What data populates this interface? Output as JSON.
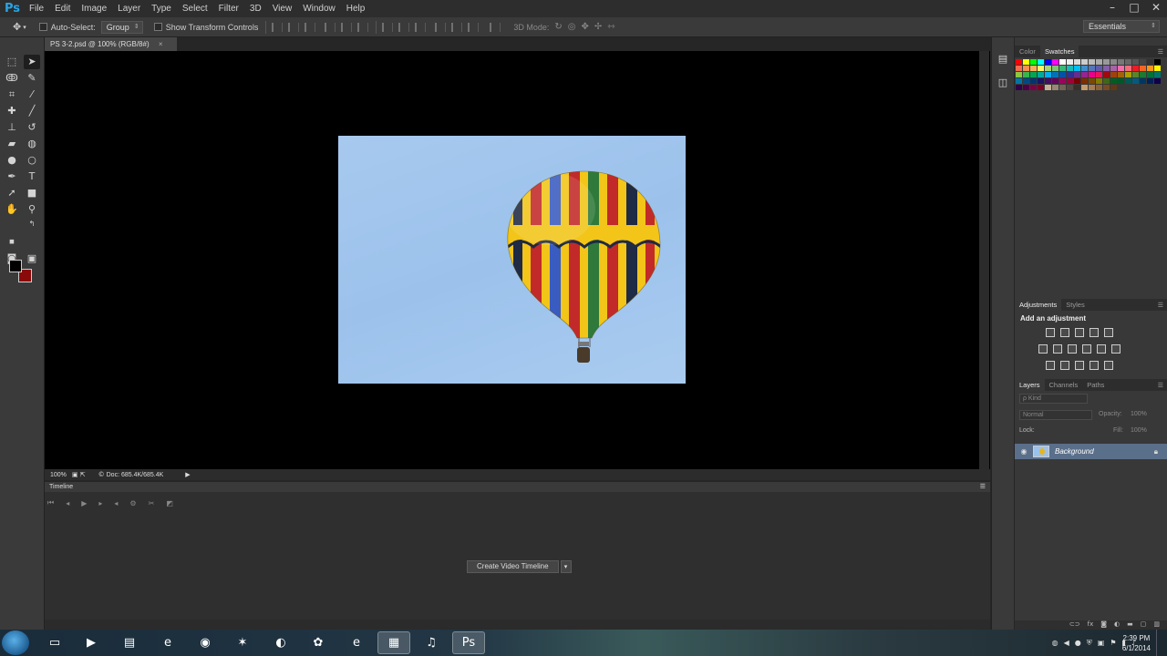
{
  "app": {
    "logo": "Ps",
    "menu": [
      "File",
      "Edit",
      "Image",
      "Layer",
      "Type",
      "Select",
      "Filter",
      "3D",
      "View",
      "Window",
      "Help"
    ],
    "window_controls": [
      "–",
      "□",
      "✕"
    ]
  },
  "options_bar": {
    "auto_select_label": "Auto-Select:",
    "auto_select_value": "Group",
    "show_transform_label": "Show Transform Controls",
    "mode_3d_label": "3D Mode:",
    "workspace": "Essentials"
  },
  "document": {
    "tab_title": "PS 3-2.psd @ 100% (RGB/8#)",
    "close_glyph": "×",
    "zoom": "100%",
    "doc_size": "Doc: 685.4K/685.4K"
  },
  "timeline": {
    "title": "Timeline",
    "create_button": "Create Video Timeline",
    "dropdown_arrow": "▾"
  },
  "panels": {
    "color_tabs": [
      "Color",
      "Swatches"
    ],
    "adjust_tabs": [
      "Adjustments",
      "Styles"
    ],
    "adjust_title": "Add an adjustment",
    "layer_tabs": [
      "Layers",
      "Channels",
      "Paths"
    ],
    "kind_label": "ρ Kind",
    "blend_mode": "Normal",
    "opacity_label": "Opacity:",
    "opacity_value": "100%",
    "lock_label": "Lock:",
    "fill_label": "Fill:",
    "fill_value": "100%",
    "layers": [
      {
        "name": "Background",
        "locked": true,
        "visible": true
      }
    ]
  },
  "taskbar": {
    "apps": [
      "explorer",
      "media",
      "folder",
      "ie-blue",
      "chrome",
      "tool",
      "edge-green",
      "flower",
      "ie",
      "app-multi",
      "headset",
      "photoshop"
    ],
    "time": "2:39 PM",
    "date": "6/1/2014"
  }
}
